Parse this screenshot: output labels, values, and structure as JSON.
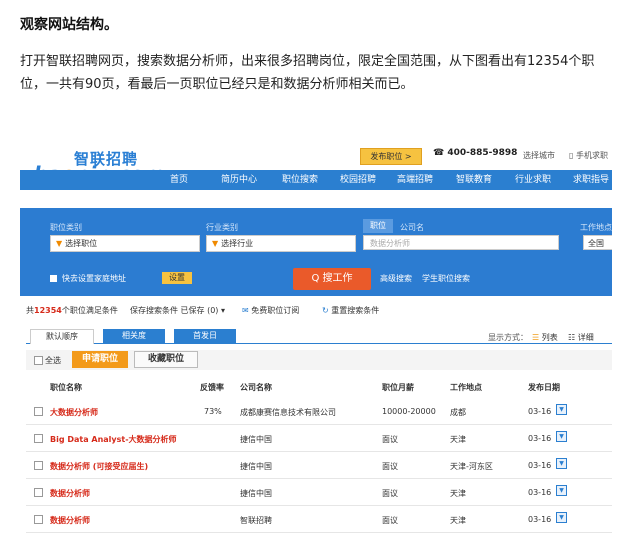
{
  "article": {
    "title": "观察网站结构。",
    "paragraph": "打开智联招聘网页，搜索数据分析师，出来很多招聘岗位，限定全国范围，从下图看出有12354个职位，一共有90页，看最后一页职位已经只是和数据分析师相关而已。"
  },
  "header": {
    "logo_cn": "智联招聘",
    "logo_en_a": "zha",
    "logo_en_o": "o",
    "logo_en_b": "pin.com",
    "post_job": "发布职位 >",
    "phone": "☎ 400-885-9898",
    "city_select": "选择城市",
    "mobile": "▯ 手机求职"
  },
  "nav": [
    "首页",
    "简历中心",
    "职位搜索",
    "校园招聘",
    "高端招聘",
    "智联教育",
    "行业求职",
    "求职指导"
  ],
  "search": {
    "category_label": "职位类别",
    "category_value": "选择职位",
    "industry_label": "行业类别",
    "industry_value": "选择行业",
    "tab_job": "职位",
    "tab_company": "公司名",
    "keyword": "数据分析师",
    "location_label": "工作地点",
    "location_value": "全国",
    "home_label": "快去设置家庭地址",
    "settings": "设置",
    "search_button": "Q 搜工作",
    "advanced": "高级搜索",
    "student": "学生职位搜索"
  },
  "results": {
    "count": "12354",
    "prefix": "共",
    "suffix": "个职位满足条件",
    "save_search": "保存搜索条件 已保存 (0) ▾",
    "free_subscribe": "免费职位订阅",
    "reset": "重置搜索条件"
  },
  "sort_tabs": [
    "默认顺序",
    "相关度",
    "首发日"
  ],
  "display": {
    "label": "显示方式：",
    "list": "列表",
    "detail": "详细"
  },
  "toolbar": {
    "select_all": "全选",
    "apply": "申请职位",
    "favorite": "收藏职位"
  },
  "table": {
    "headers": [
      "职位名称",
      "反馈率",
      "公司名称",
      "职位月薪",
      "工作地点",
      "发布日期"
    ],
    "rows": [
      {
        "title": "大数据分析师",
        "rate": "73%",
        "company": "成都康赛信息技术有限公司",
        "salary": "10000-20000",
        "location": "成都",
        "date": "03-16"
      },
      {
        "title": "Big Data Analyst-大数据分析师",
        "rate": "",
        "company": "捷信中国",
        "salary": "面议",
        "location": "天津",
        "date": "03-16"
      },
      {
        "title": "数据分析师 (可接受应届生)",
        "rate": "",
        "company": "捷信中国",
        "salary": "面议",
        "location": "天津-河东区",
        "date": "03-16"
      },
      {
        "title": "数据分析师",
        "rate": "",
        "company": "捷信中国",
        "salary": "面议",
        "location": "天津",
        "date": "03-16"
      },
      {
        "title": "数据分析师",
        "rate": "",
        "company": "智联招聘",
        "salary": "面议",
        "location": "天津",
        "date": "03-16"
      }
    ]
  }
}
